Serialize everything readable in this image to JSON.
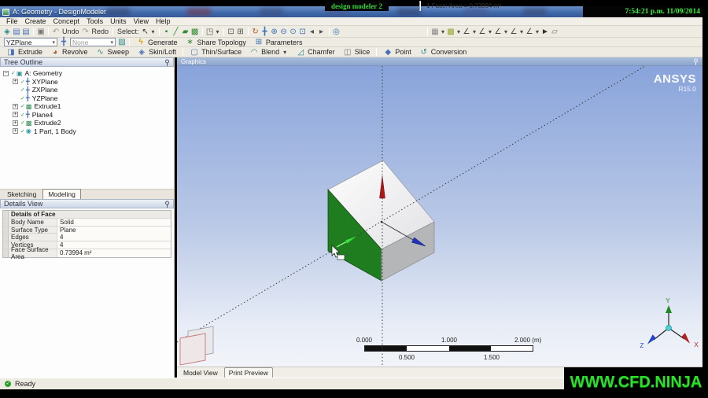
{
  "titlebar": {
    "title": "A: Geometry - DesignModeler",
    "clock": "7:54:21 p.m. 11/09/2014"
  },
  "menu": {
    "items": [
      "File",
      "Create",
      "Concept",
      "Tools",
      "Units",
      "View",
      "Help"
    ]
  },
  "toolbar1": {
    "select_label": "Select:",
    "undo_label": "Undo",
    "redo_label": "Redo"
  },
  "toolbar2": {
    "plane_selector": "YZPlane",
    "sketch_selector": "None",
    "generate_label": "Generate",
    "share_topology_label": "Share Topology",
    "parameters_label": "Parameters"
  },
  "toolbar3": {
    "buttons": [
      {
        "label": "Extrude",
        "icon": "extrude-tool-icon",
        "glyph": "◨",
        "color": "#4a6fb5"
      },
      {
        "label": "Revolve",
        "icon": "revolve-tool-icon",
        "glyph": "◕",
        "color": "#a0622a"
      },
      {
        "label": "Sweep",
        "icon": "sweep-tool-icon",
        "glyph": "∿",
        "color": "#2a8a8a"
      },
      {
        "label": "Skin/Loft",
        "icon": "skinloft-tool-icon",
        "glyph": "◈",
        "color": "#4a6fb5"
      },
      {
        "label": "Thin/Surface",
        "icon": "thinsurface-tool-icon",
        "glyph": "▢",
        "color": "#4a6fb5"
      },
      {
        "label": "Blend",
        "icon": "blend-tool-icon",
        "glyph": "◠",
        "color": "#2a8a8a",
        "dropdown": true
      },
      {
        "label": "Chamfer",
        "icon": "chamfer-tool-icon",
        "glyph": "◿",
        "color": "#2a8a8a"
      },
      {
        "label": "Slice",
        "icon": "slice-tool-icon",
        "glyph": "◫",
        "color": "#777777"
      },
      {
        "label": "Point",
        "icon": "point-tool-icon",
        "glyph": "◆",
        "color": "#4a6fb5"
      },
      {
        "label": "Conversion",
        "icon": "conversion-tool-icon",
        "glyph": "↺",
        "color": "#2a8a8a"
      }
    ],
    "separators_after": [
      3,
      7
    ]
  },
  "tree": {
    "header": "Tree Outline",
    "items": [
      {
        "label": "A: Geometry",
        "icon": "geometry-icon",
        "glyph": "▣",
        "color": "#2a8f8f",
        "expander": "minus",
        "root": true
      },
      {
        "label": "XYPlane",
        "icon": "plane-icon",
        "glyph": "╋",
        "color": "#4a6fb5",
        "expander": "plus"
      },
      {
        "label": "ZXPlane",
        "icon": "plane-icon",
        "glyph": "╋",
        "color": "#4a6fb5",
        "expander": "none"
      },
      {
        "label": "YZPlane",
        "icon": "plane-icon",
        "glyph": "╋",
        "color": "#4a6fb5",
        "expander": "none"
      },
      {
        "label": "Extrude1",
        "icon": "extrude-icon",
        "glyph": "▩",
        "color": "#2e8b57",
        "expander": "plus"
      },
      {
        "label": "Plane4",
        "icon": "plane-icon",
        "glyph": "╋",
        "color": "#4a6fb5",
        "expander": "plus"
      },
      {
        "label": "Extrude2",
        "icon": "extrude-icon",
        "glyph": "▩",
        "color": "#2e8b57",
        "expander": "plus"
      },
      {
        "label": "1 Part, 1 Body",
        "icon": "part-icon",
        "glyph": "◉",
        "color": "#2a9aaa",
        "expander": "plus"
      }
    ]
  },
  "mode_tabs": {
    "sketching": "Sketching",
    "modeling": "Modeling"
  },
  "details": {
    "header": "Details View",
    "group_header": "Details of Face",
    "rows": [
      {
        "label": "Body Name",
        "value": "Solid"
      },
      {
        "label": "Surface Type",
        "value": "Plane"
      },
      {
        "label": "Edges",
        "value": "4"
      },
      {
        "label": "Vertices",
        "value": "4"
      },
      {
        "label": "Face Surface Area",
        "value": "0.73994 m²"
      }
    ]
  },
  "graphics": {
    "header": "Graphics",
    "brand": "ANSYS",
    "brand_version": "R15.0",
    "face_color": "#1f7d1f",
    "ruler": {
      "top_labels": [
        "0.000",
        "1.000",
        "2.000 (m)"
      ],
      "bottom_labels": [
        "0.500",
        "1.500"
      ]
    },
    "view_tabs": [
      "Model View",
      "Print Preview"
    ],
    "triad": {
      "x_label": "X",
      "y_label": "Y",
      "z_label": "Z",
      "x_color": "#b22222",
      "y_color": "#1e8a1e",
      "z_color": "#2244cc"
    }
  },
  "statusbar": {
    "ready": "Ready",
    "badge": "design modeler 2",
    "selection_info": "1 Face: Area = 0.73994 m²",
    "overlay_brand": "WWW.CFD.NINJA",
    "overlay_color": "#2be02b"
  },
  "icons": {
    "new_sketch": "◈",
    "save": "▤",
    "capture": "▣",
    "undo": "↶",
    "redo": "↷",
    "cursor": "↖",
    "dropdown": "▾",
    "filter_vertex": "▪",
    "filter_edge": "╱",
    "filter_face": "▰",
    "filter_body": "▩",
    "extend_select": "◳",
    "box_in": "⊡",
    "box_out": "⊞",
    "rotate": "↻",
    "pan": "╋",
    "zoom_in": "⊕",
    "zoom_out": "⊖",
    "zoom_fit": "⊙",
    "prev_view": "◂",
    "next_view": "▸",
    "look_at": "◎",
    "display_style": "▦",
    "color_style": "▩",
    "edge_style": "∠",
    "pointer": "►",
    "flag": "▱",
    "plane": "╋",
    "sketch": "▨",
    "generate": "ϟ",
    "share_topology": "∗",
    "parameters": "⊞",
    "check": "✓"
  }
}
